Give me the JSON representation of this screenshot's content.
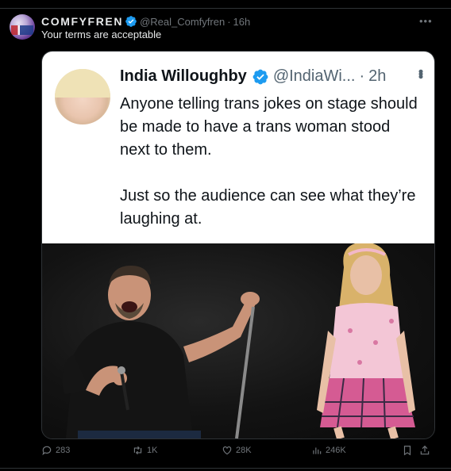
{
  "post": {
    "display_name": "COMFYFREN",
    "handle": "@Real_Comfyfren",
    "separator": "·",
    "time": "16h",
    "text": "Your terms are acceptable",
    "more_icon": "more-horizontal-icon"
  },
  "quoted_screenshot": {
    "name": "India Willoughby",
    "handle": "@IndiaWi...",
    "separator": "·",
    "time": "2h",
    "paragraphs": [
      "Anyone telling trans jokes on stage should be made to have a trans woman stood next to them.",
      "Just so the audience can see what they’re laughing at."
    ]
  },
  "actions": {
    "reply": {
      "icon": "reply-icon",
      "count": "283"
    },
    "repost": {
      "icon": "repost-icon",
      "count": "1K"
    },
    "like": {
      "icon": "heart-icon",
      "count": "28K"
    },
    "views": {
      "icon": "views-icon",
      "count": "246K"
    },
    "bookmark": {
      "icon": "bookmark-icon"
    },
    "share": {
      "icon": "share-icon"
    }
  },
  "colors": {
    "background": "#000000",
    "text_primary": "#e7e9ea",
    "text_secondary": "#71767b",
    "verified_blue": "#1d9bf0",
    "divider": "#2f3336"
  }
}
